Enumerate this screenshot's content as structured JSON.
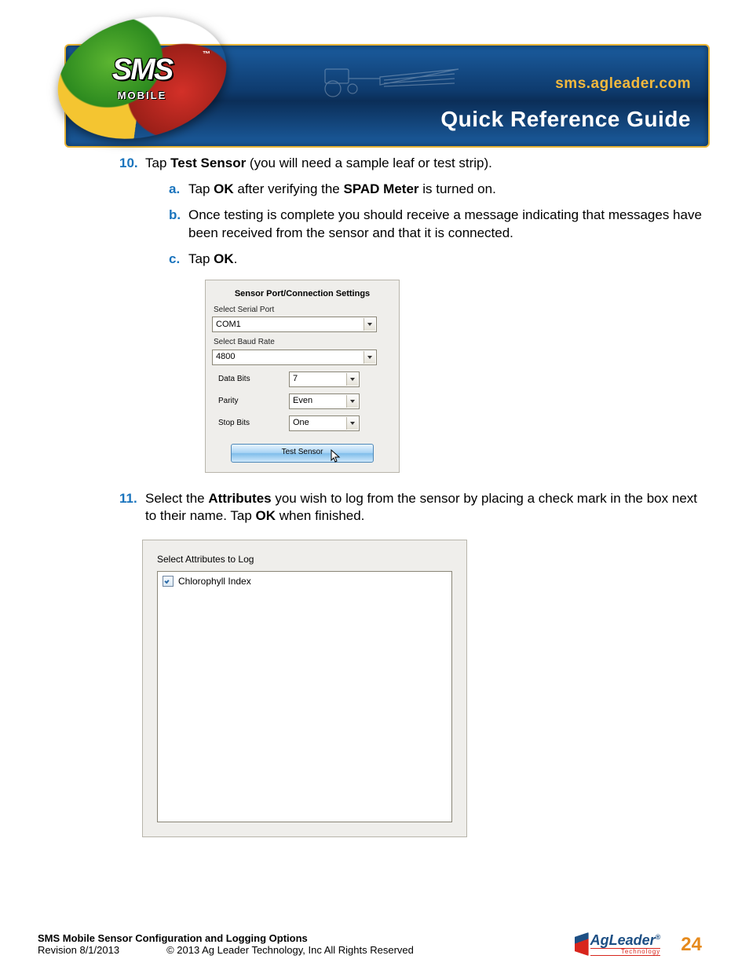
{
  "header": {
    "url": "sms.agleader.com",
    "title": "Quick Reference Guide",
    "logo_main": "SMS",
    "logo_tm": "™",
    "logo_sub": "MOBILE"
  },
  "steps": {
    "s10": {
      "pre": "Tap ",
      "bold1": "Test Sensor",
      "post": " (you will need a sample leaf or test strip).",
      "a": {
        "pre": "Tap ",
        "ok": "OK",
        "mid": " after verifying the ",
        "spad": "SPAD Meter",
        "post": " is turned on."
      },
      "b": "Once testing is complete you should receive a message indicating that messages have been received from the sensor and that it is connected.",
      "c": {
        "pre": "Tap ",
        "ok": "OK",
        "post": "."
      }
    },
    "s11": {
      "pre": "Select the ",
      "bold": "Attributes",
      "mid": " you wish to log from the sensor by placing a check mark in the box next to their name. Tap ",
      "ok": "OK",
      "post": " when finished."
    }
  },
  "dialog": {
    "title": "Sensor Port/Connection Settings",
    "port_label": "Select Serial Port",
    "port_value": "COM1",
    "baud_label": "Select Baud Rate",
    "baud_value": "4800",
    "databits_label": "Data Bits",
    "databits_value": "7",
    "parity_label": "Parity",
    "parity_value": "Even",
    "stopbits_label": "Stop Bits",
    "stopbits_value": "One",
    "test_button": "Test Sensor"
  },
  "attrdlg": {
    "title": "Select Attributes to Log",
    "item1": "Chlorophyll Index"
  },
  "footer": {
    "title": "SMS Mobile Sensor Configuration and Logging Options",
    "revision": "Revision 8/1/2013",
    "copyright": "© 2013 Ag Leader Technology, Inc All Rights Reserved",
    "page": "24",
    "logo_ag": "Ag",
    "logo_leader": "Leader",
    "logo_reg": "®",
    "logo_tech": "Technology"
  }
}
